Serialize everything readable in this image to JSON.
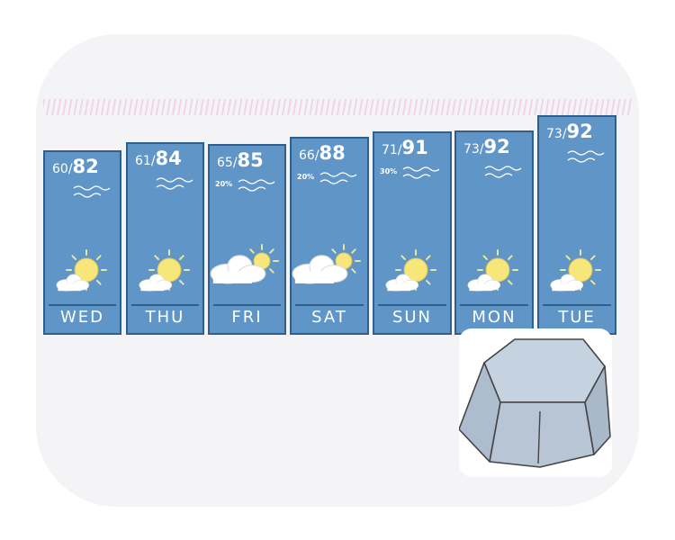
{
  "forecast": [
    {
      "day": "WED",
      "low": "60",
      "high": "82",
      "precip": "",
      "icon": "partly-sunny-icon"
    },
    {
      "day": "THU",
      "low": "61",
      "high": "84",
      "precip": "",
      "icon": "partly-sunny-icon"
    },
    {
      "day": "FRI",
      "low": "65",
      "high": "85",
      "precip": "20%",
      "icon": "cloudy-sun-icon"
    },
    {
      "day": "SAT",
      "low": "66",
      "high": "88",
      "precip": "20%",
      "icon": "cloudy-sun-icon"
    },
    {
      "day": "SUN",
      "low": "71",
      "high": "91",
      "precip": "30%",
      "icon": "partly-sunny-icon"
    },
    {
      "day": "MON",
      "low": "73",
      "high": "92",
      "precip": "",
      "icon": "partly-sunny-icon"
    },
    {
      "day": "TUE",
      "low": "73",
      "high": "92",
      "precip": "",
      "icon": "partly-sunny-icon"
    }
  ],
  "colors": {
    "card": "#5f95c7",
    "card_border": "#2f5f8e",
    "sun": "#f7e77a",
    "cloud": "#ffffff",
    "keycap": "#b8c6d6"
  }
}
